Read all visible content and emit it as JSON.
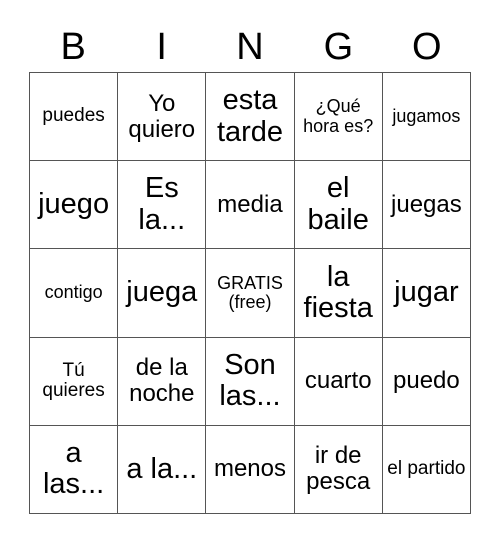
{
  "header": [
    "B",
    "I",
    "N",
    "G",
    "O"
  ],
  "cells": [
    {
      "text": "puedes",
      "size": "s1"
    },
    {
      "text": "Yo quiero",
      "size": "s2"
    },
    {
      "text": "esta tarde",
      "size": "s3"
    },
    {
      "text": "¿Qué hora es?",
      "size": "s4"
    },
    {
      "text": "jugamos",
      "size": "s4"
    },
    {
      "text": "juego",
      "size": "s3"
    },
    {
      "text": "Es la...",
      "size": "s3"
    },
    {
      "text": "media",
      "size": "s2"
    },
    {
      "text": "el baile",
      "size": "s3"
    },
    {
      "text": "juegas",
      "size": "s2"
    },
    {
      "text": "contigo",
      "size": "s4"
    },
    {
      "text": "juega",
      "size": "s3"
    },
    {
      "text": "GRATIS (free)",
      "size": "s4"
    },
    {
      "text": "la fiesta",
      "size": "s3"
    },
    {
      "text": "jugar",
      "size": "s3"
    },
    {
      "text": "Tú quieres",
      "size": "s1"
    },
    {
      "text": "de la noche",
      "size": "s2"
    },
    {
      "text": "Son las...",
      "size": "s3"
    },
    {
      "text": "cuarto",
      "size": "s2"
    },
    {
      "text": "puedo",
      "size": "s2"
    },
    {
      "text": "a las...",
      "size": "s3"
    },
    {
      "text": "a la...",
      "size": "s3"
    },
    {
      "text": "menos",
      "size": "s2"
    },
    {
      "text": "ir de pesca",
      "size": "s2"
    },
    {
      "text": "el partido",
      "size": "s1"
    }
  ]
}
